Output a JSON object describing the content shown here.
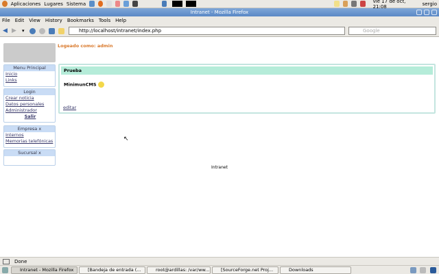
{
  "top_panel": {
    "menus": [
      "Aplicaciones",
      "Lugares",
      "Sistema"
    ],
    "clock": "vie 17 de oct, 21:08",
    "user": "sergio"
  },
  "window": {
    "title": "Intranet - Mozilla Firefox"
  },
  "menubar": [
    "File",
    "Edit",
    "View",
    "History",
    "Bookmarks",
    "Tools",
    "Help"
  ],
  "navbar": {
    "url": "http://localhost/intranet/index.php",
    "search_placeholder": "Google"
  },
  "page": {
    "logged_as": "Logeado como: admin",
    "menus": [
      {
        "title": "Menu Principal",
        "links": [
          "Inicio",
          "Links"
        ]
      },
      {
        "title": "Login",
        "links": [
          "Crear noticia",
          "Datos personales",
          "Administrador"
        ],
        "bold_link": "Salir"
      },
      {
        "title": "Empresa x",
        "links": [
          "Internos",
          "Memorias telefónicas"
        ]
      },
      {
        "title": "Sucursal x",
        "links": []
      }
    ],
    "main": {
      "header": "Prueba",
      "body": "MinimunCMS",
      "edit": "editar"
    },
    "footer": "Intranet"
  },
  "status": "Done",
  "taskbar": [
    "Intranet - Mozilla Firefox",
    "[Bandeja de entrada (...",
    "root@ardillas: /var/ww...",
    "[SourceForge.net Proj...",
    "Downloads"
  ]
}
